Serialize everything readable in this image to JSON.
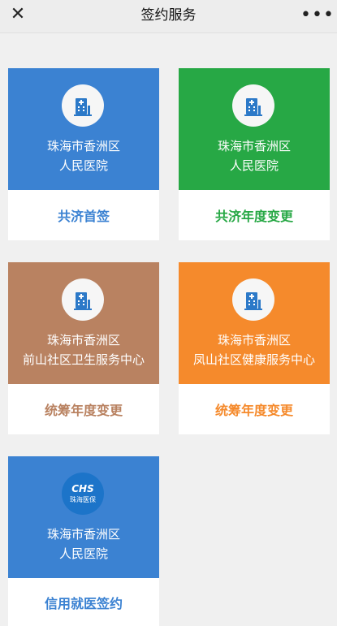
{
  "topbar": {
    "title": "签约服务"
  },
  "cards": [
    {
      "line1": "珠海市香洲区",
      "line2": "人民医院",
      "action": "共济首签",
      "top_color": "#3b82d2",
      "action_color": "#3b82d2",
      "icon": "hospital-icon"
    },
    {
      "line1": "珠海市香洲区",
      "line2": "人民医院",
      "action": "共济年度变更",
      "top_color": "#27a845",
      "action_color": "#27a845",
      "icon": "hospital-icon"
    },
    {
      "line1": "珠海市香洲区",
      "line2": "前山社区卫生服务中心",
      "action": "统筹年度变更",
      "top_color": "#b98261",
      "action_color": "#b98261",
      "icon": "hospital-icon"
    },
    {
      "line1": "珠海市香洲区",
      "line2": "凤山社区健康服务中心",
      "action": "统筹年度变更",
      "top_color": "#f58a2c",
      "action_color": "#f58a2c",
      "icon": "hospital-icon"
    },
    {
      "line1": "珠海市香洲区",
      "line2": "人民医院",
      "action": "信用就医签约",
      "top_color": "#3b82d2",
      "action_color": "#3b82d2",
      "icon": "chs-logo-icon",
      "logo_text": "CHS",
      "logo_sub": "珠海医保"
    }
  ]
}
